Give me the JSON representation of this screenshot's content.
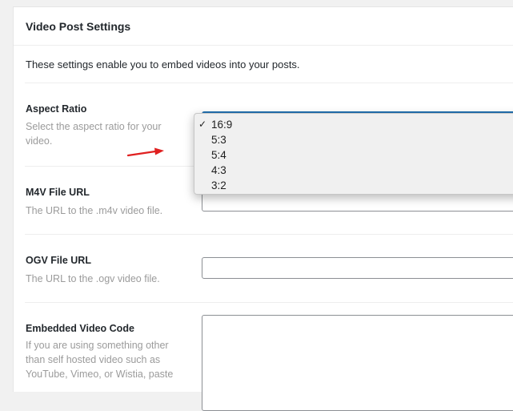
{
  "section": {
    "title": "Video Post Settings",
    "intro": "These settings enable you to embed videos into your posts."
  },
  "fields": {
    "aspect_ratio": {
      "label": "Aspect Ratio",
      "description": "Select the aspect ratio for your video.",
      "selected": "16:9",
      "options": [
        "16:9",
        "5:3",
        "5:4",
        "4:3",
        "3:2"
      ]
    },
    "m4v": {
      "label": "M4V File URL",
      "description": "The URL to the .m4v video file.",
      "value": ""
    },
    "ogv": {
      "label": "OGV File URL",
      "description": "The URL to the .ogv video file.",
      "value": ""
    },
    "embed": {
      "label": "Embedded Video Code",
      "description": "If you are using something other than self hosted video such as YouTube, Vimeo, or Wistia, paste",
      "value": ""
    }
  },
  "colors": {
    "arrow": "#e02020",
    "focus": "#2271b1"
  }
}
